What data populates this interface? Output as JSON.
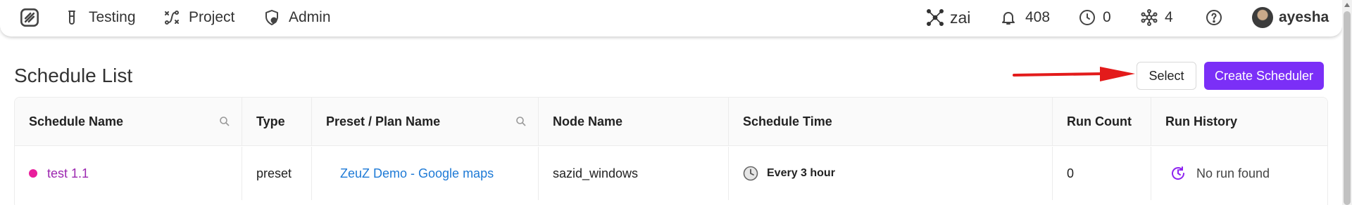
{
  "nav": {
    "items": [
      {
        "label": "Testing",
        "icon": "test-tube-icon"
      },
      {
        "label": "Project",
        "icon": "project-flow-icon"
      },
      {
        "label": "Admin",
        "icon": "admin-shield-icon"
      }
    ],
    "right": {
      "team": "zai",
      "notifications": "408",
      "running": "0",
      "nodes": "4",
      "help_icon": "help-icon",
      "user": "ayesha"
    }
  },
  "page": {
    "title": "Schedule List",
    "select_label": "Select",
    "create_label": "Create Scheduler"
  },
  "table": {
    "headers": [
      "Schedule Name",
      "Type",
      "Preset / Plan Name",
      "Node Name",
      "Schedule Time",
      "Run Count",
      "Run History"
    ],
    "rows": [
      {
        "schedule_name": "test 1.1",
        "type": "preset",
        "plan_name": "ZeuZ Demo - Google maps",
        "node_name": "sazid_windows",
        "schedule_time": "Every 3 hour",
        "run_count": "0",
        "run_history": "No run found"
      }
    ]
  },
  "colors": {
    "accent": "#7b2ff7",
    "status_dot": "#e91e9c",
    "link": "#1e7ad6",
    "schedule_link": "#9c27b0",
    "annotation_arrow": "#e31b1b"
  }
}
